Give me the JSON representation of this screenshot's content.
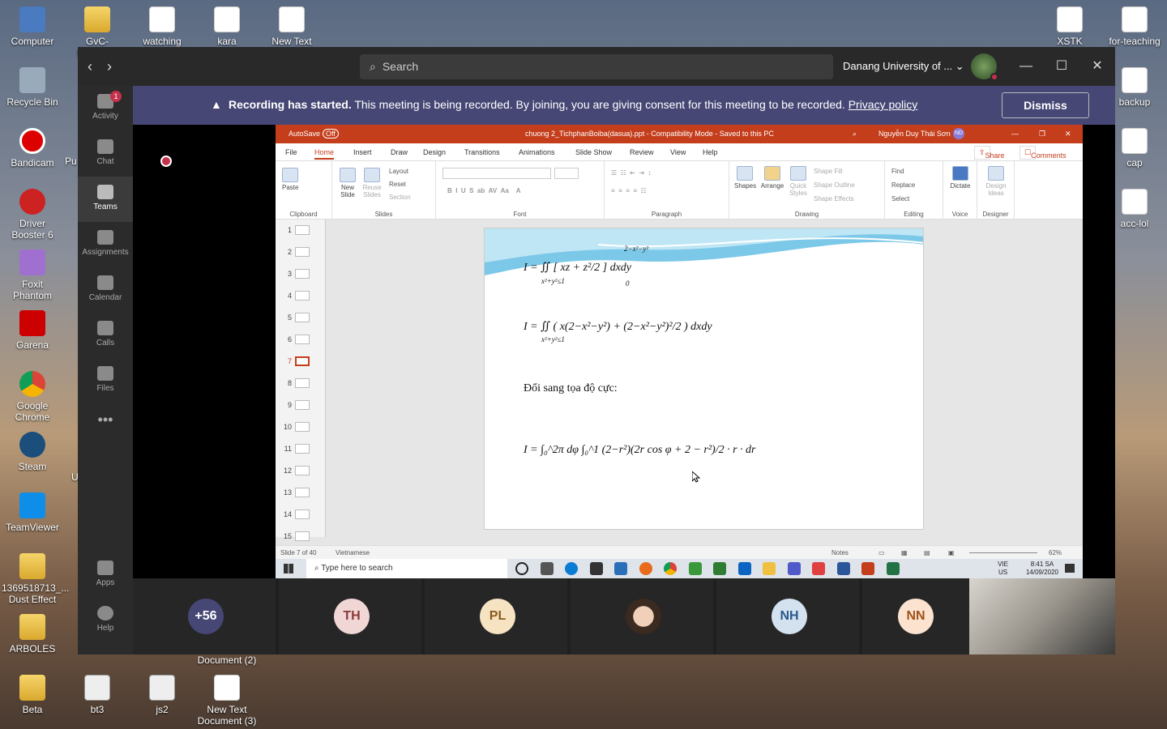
{
  "desktop": {
    "icons_left": [
      "Computer",
      "Recycle Bin",
      "Bandicam",
      "Driver Booster 6",
      "Foxit Phantom",
      "Garena",
      "Google Chrome",
      "Steam",
      "TeamViewer",
      "1369518713_... Dust Effect",
      "ARBOLES",
      "Beta"
    ],
    "icons_top": [
      "GvC-Launcher",
      "watching",
      "kara",
      "New Text"
    ],
    "icons_right": [
      "XSTK",
      "for-teaching",
      "backup",
      "cap",
      "acc-lol"
    ],
    "icons_bottom": [
      "bt3",
      "js2",
      "New Text Document (3)"
    ],
    "partial_labels": [
      "Pu",
      "U"
    ],
    "doc2_label": "Document (2)"
  },
  "teams": {
    "search_placeholder": "Search",
    "org_name": "Danang University of ...",
    "rail": [
      {
        "label": "Activity",
        "badge": "1"
      },
      {
        "label": "Chat"
      },
      {
        "label": "Teams"
      },
      {
        "label": "Assignments"
      },
      {
        "label": "Calendar"
      },
      {
        "label": "Calls"
      },
      {
        "label": "Files"
      }
    ],
    "rail_more": "•••",
    "rail_bottom": [
      "Apps",
      "Help"
    ],
    "banner": {
      "bold": "Recording has started.",
      "text": "This meeting is being recorded. By joining, you are giving consent for this meeting to be recorded.",
      "link": "Privacy policy",
      "dismiss": "Dismiss"
    },
    "participants": [
      {
        "initials": "+56",
        "bg": "#464775",
        "fg": "#ffffff"
      },
      {
        "initials": "TH",
        "bg": "#f1d6d6",
        "fg": "#8a3a3a"
      },
      {
        "initials": "PL",
        "bg": "#f6e3c2",
        "fg": "#8a5a1a"
      },
      {
        "initials": "",
        "bg": "#cfcfcf",
        "fg": "#333333"
      },
      {
        "initials": "NH",
        "bg": "#d4e2f0",
        "fg": "#2a5a8a"
      },
      {
        "initials": "NN",
        "bg": "#fbe3cf",
        "fg": "#a0521a"
      }
    ]
  },
  "ppt": {
    "autosave": "AutoSave",
    "autosave_state": "Off",
    "file_title": "chuong 2_TichphanBoiba(dasua).ppt - Compatibility Mode - Saved to this PC",
    "user": "Nguyễn Duy Thái Sơn",
    "user_initials": "ND",
    "tabs": [
      "File",
      "Home",
      "Insert",
      "Draw",
      "Design",
      "Transitions",
      "Animations",
      "Slide Show",
      "Review",
      "View",
      "Help"
    ],
    "share": "Share",
    "comments": "Comments",
    "ribbon": {
      "clipboard": "Clipboard",
      "paste": "Paste",
      "slides": "Slides",
      "new_slide": "New Slide",
      "reuse": "Reuse Slides",
      "layout": "Layout",
      "reset": "Reset",
      "section": "Section",
      "font": "Font",
      "paragraph": "Paragraph",
      "drawing": "Drawing",
      "shapes": "Shapes",
      "arrange": "Arrange",
      "quick_styles": "Quick Styles",
      "shape_fill": "Shape Fill",
      "shape_outline": "Shape Outline",
      "shape_effects": "Shape Effects",
      "editing": "Editing",
      "find": "Find",
      "replace": "Replace",
      "select": "Select",
      "voice": "Voice",
      "dictate": "Dictate",
      "designer": "Designer",
      "design_ideas": "Design Ideas"
    },
    "thumbs": [
      "1",
      "2",
      "3",
      "4",
      "5",
      "6",
      "7",
      "8",
      "9",
      "10",
      "11",
      "12",
      "13",
      "14",
      "15"
    ],
    "selected_slide": "7",
    "slide": {
      "eq1": "I = ∬ [ xz + z²/2 ] dxdy",
      "eq1_sub": "x²+y²≤1",
      "eq1_upper": "2−x²−y²",
      "eq1_lower": "0",
      "eq2": "I = ∬ ( x(2−x²−y²) + (2−x²−y²)²/2 ) dxdy",
      "eq2_sub": "x²+y²≤1",
      "heading": "Đổi sang tọa độ cực:",
      "eq3": "I = ∫₀^2π dφ ∫₀^1 (2−r²)(2r cos φ + 2 − r²)/2 · r · dr"
    },
    "status_slide": "Slide 7 of 40",
    "status_lang": "Vietnamese",
    "notes": "Notes",
    "zoom": "62%",
    "taskbar_search": "Type here to search",
    "lang": "VIE",
    "lang2": "US",
    "time": "8:41 SA",
    "date": "14/09/2020"
  }
}
